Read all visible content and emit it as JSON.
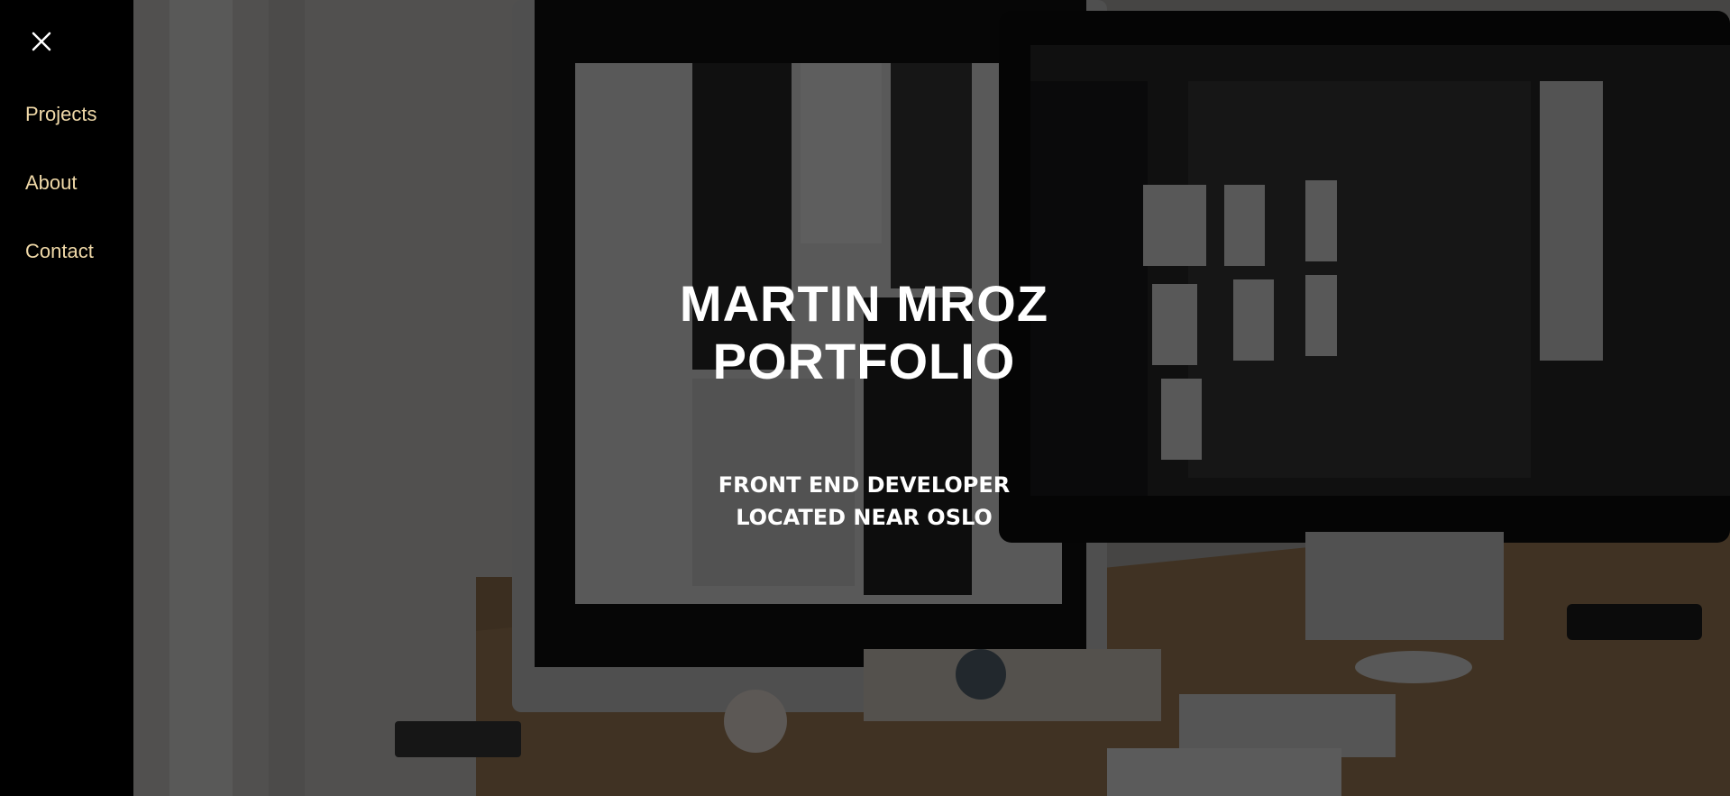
{
  "sidebar": {
    "close_icon": "close-icon",
    "items": [
      {
        "label": "Projects"
      },
      {
        "label": "About"
      },
      {
        "label": "Contact"
      }
    ],
    "link_color": "#f0d9a8",
    "background": "#000000"
  },
  "hero": {
    "title_line1": "MARTIN MROZ",
    "title_line2": "PORTFOLIO",
    "subtitle_line1": "FRONT END DEVELOPER",
    "subtitle_line2": "LOCATED NEAR OSLO",
    "text_color": "#ffffff"
  }
}
